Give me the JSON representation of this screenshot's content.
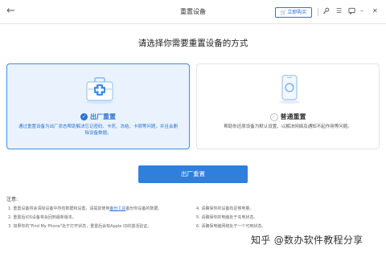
{
  "window": {
    "title": "重置设备",
    "back_icon": "back-arrow-icon",
    "buy_label": "立即购买",
    "toolbar_icons": [
      "key-icon",
      "menu-icon",
      "feedback-icon",
      "minimize-icon",
      "close-icon"
    ]
  },
  "heading": "请选择你需要重置设备的方式",
  "options": [
    {
      "title": "出厂重置",
      "desc_before": "通过重置设备为出厂状态帮助解决忘记密码、卡死、冻结、卡顿等问题，并且会删除设备数据。",
      "selected": true
    },
    {
      "title": "普通重置",
      "desc_before": "帮助你还原设备为默认设置，以解决网络及通知不起作用等问题。",
      "selected": false
    }
  ],
  "main_button": "出厂重置",
  "notes": {
    "title": "注意:",
    "items": [
      {
        "text_before": "1.  重置设备将会清除设备中所有数据和设置，请提前使用",
        "link": "备份工具",
        "text_after": "备份你设备的数据。"
      },
      {
        "text_before": "2.  重置后iOS设备将会回到最新版本。",
        "link": "",
        "text_after": ""
      },
      {
        "text_before": "3.  如果你的\"Find My Phone\"处于打开状态，重置后会有Apple ID的激活验证。",
        "link": "",
        "text_after": ""
      },
      {
        "text_before": "4.  请确保你的设备有足够电量。",
        "link": "",
        "text_after": ""
      },
      {
        "text_before": "5.  请确保你的电脑处于充电状态。",
        "link": "",
        "text_after": ""
      },
      {
        "text_before": "6.  请确保电脑网络处于一个可用状态。",
        "link": "",
        "text_after": ""
      }
    ]
  },
  "watermark": "知乎 @数办软件教程分享"
}
